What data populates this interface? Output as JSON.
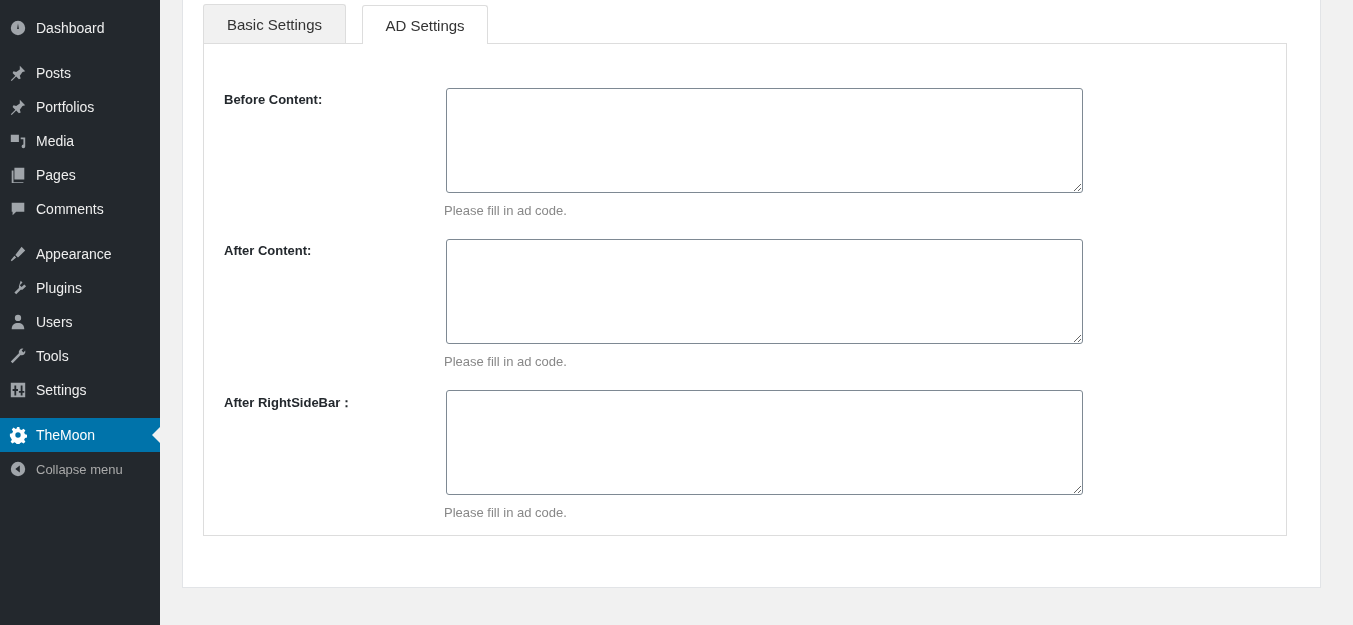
{
  "sidebar": {
    "groups": [
      {
        "items": [
          {
            "label": "Dashboard",
            "selected": false
          }
        ]
      },
      {
        "items": [
          {
            "label": "Posts",
            "selected": false
          },
          {
            "label": "Portfolios",
            "selected": false
          },
          {
            "label": "Media",
            "selected": false
          },
          {
            "label": "Pages",
            "selected": false
          },
          {
            "label": "Comments",
            "selected": false
          }
        ]
      },
      {
        "items": [
          {
            "label": "Appearance",
            "selected": false
          },
          {
            "label": "Plugins",
            "selected": false
          },
          {
            "label": "Users",
            "selected": false
          },
          {
            "label": "Tools",
            "selected": false
          },
          {
            "label": "Settings",
            "selected": false
          }
        ]
      },
      {
        "items": [
          {
            "label": "TheMoon",
            "selected": true
          }
        ]
      }
    ],
    "collapse": "Collapse menu"
  },
  "tabs": [
    {
      "label": "Basic Settings",
      "selected": false
    },
    {
      "label": "AD Settings",
      "selected": true
    }
  ],
  "fields": [
    {
      "label": "Before Content:",
      "hint": "Please fill in ad code."
    },
    {
      "label": "After Content:",
      "hint": "Please fill in ad code."
    },
    {
      "label": "After RightSideBar：",
      "hint": "Please fill in ad code."
    }
  ]
}
